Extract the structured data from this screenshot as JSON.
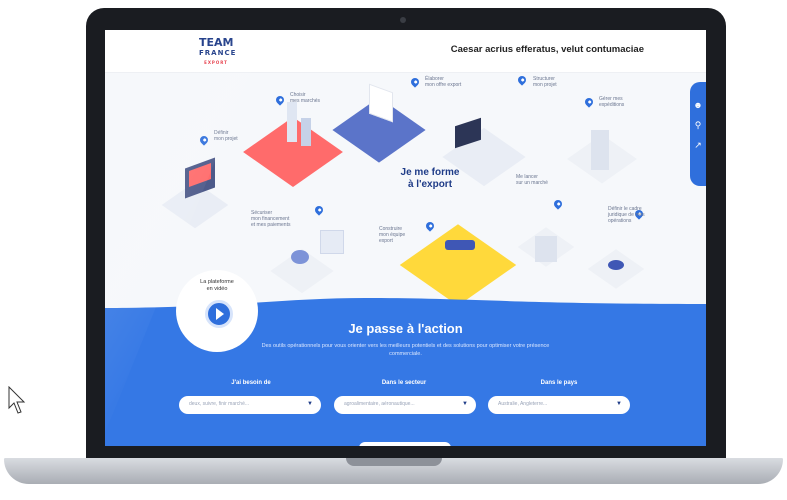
{
  "header": {
    "logo_line1": "TEAM",
    "logo_line2": "FRANCE",
    "logo_line3": "EXPORT",
    "title": "Caesar acrius efferatus, velut contumaciae"
  },
  "sidebar": {
    "icons": [
      "user-icon",
      "search-icon",
      "share-icon"
    ]
  },
  "hero": {
    "center_title": "Je me forme\nà l'export",
    "labels": {
      "definir": "Définir\nmon projet",
      "choisir": "Choisir\nmes marchés",
      "elaborer": "Élaborer\nmon offre export",
      "structurer": "Structurer\nmon projet",
      "gerer": "Gérer mes\nexpéditions",
      "securiser": "Sécuriser\nmon financement\net mes paiements",
      "construire": "Construire\nmon équipe\nexport",
      "me_lancer": "Me lancer\nsur un marché",
      "definir_cadre": "Définir le cadre\njuridique de mes\nopérations"
    }
  },
  "video": {
    "label": "La plateforme\nen vidéo"
  },
  "action": {
    "title": "Je passe à l'action",
    "subtitle": "Des outils opérationnels pour vous orienter vers les meilleurs potentiels et des solutions pour optimiser votre présence commerciale."
  },
  "filters": [
    {
      "label": "J'ai besoin de",
      "placeholder": "deux, suivre, finir marché..."
    },
    {
      "label": "Dans le secteur",
      "placeholder": "agroalimentaire, aéronautique..."
    },
    {
      "label": "Dans le pays",
      "placeholder": "Australie, Angleterre..."
    }
  ],
  "colors": {
    "accent": "#2f6fdc",
    "action_bg": "#3578e5",
    "brand_dark": "#1f3c88"
  }
}
